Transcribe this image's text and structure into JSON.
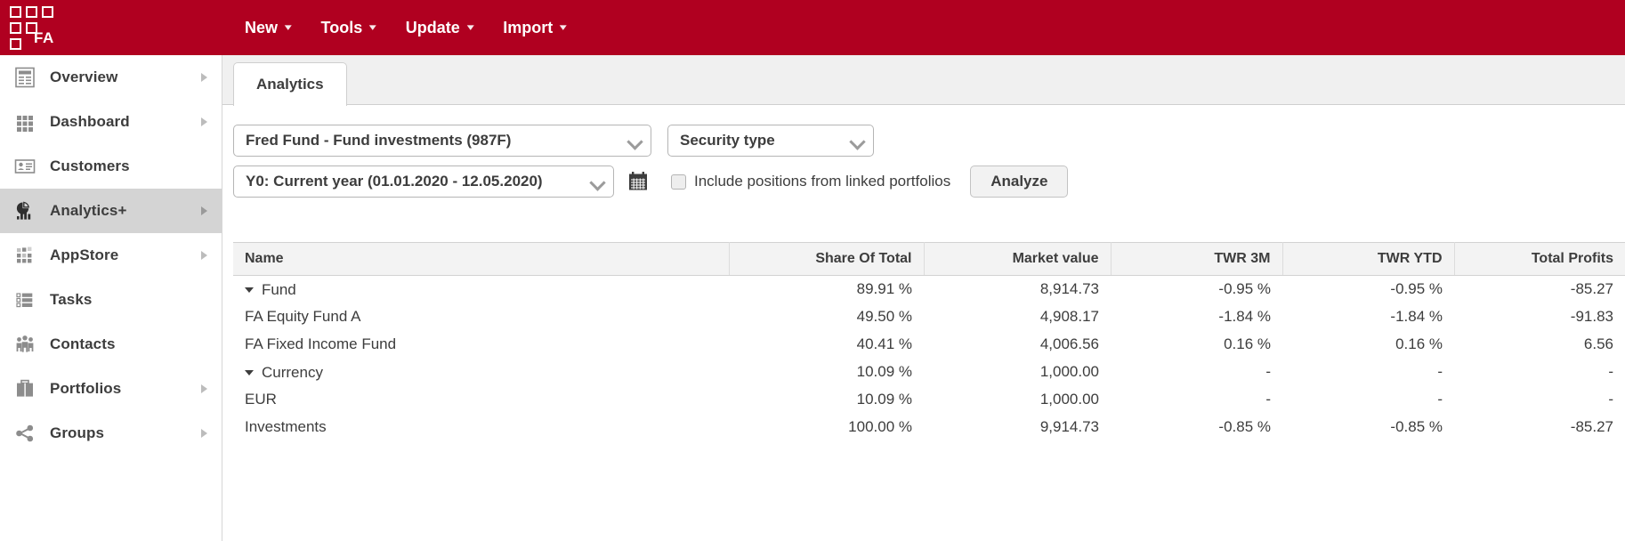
{
  "brand": {
    "name": "FA",
    "color": "#b00020",
    "logo_icon": "fa-squares-logo"
  },
  "topmenu": {
    "items": [
      {
        "label": "New",
        "icon": "chevron-down-icon"
      },
      {
        "label": "Tools",
        "icon": "chevron-down-icon"
      },
      {
        "label": "Update",
        "icon": "chevron-down-icon"
      },
      {
        "label": "Import",
        "icon": "chevron-down-icon"
      }
    ]
  },
  "sidebar": {
    "items": [
      {
        "label": "Overview",
        "icon": "document-overview-icon",
        "has_arrow": true,
        "active": false
      },
      {
        "label": "Dashboard",
        "icon": "grid-dots-icon",
        "has_arrow": true,
        "active": false
      },
      {
        "label": "Customers",
        "icon": "id-card-icon",
        "has_arrow": false,
        "active": false
      },
      {
        "label": "Analytics+",
        "icon": "pie-bar-chart-icon",
        "has_arrow": true,
        "active": true
      },
      {
        "label": "AppStore",
        "icon": "app-grid-icon",
        "has_arrow": true,
        "active": false
      },
      {
        "label": "Tasks",
        "icon": "checklist-icon",
        "has_arrow": false,
        "active": false
      },
      {
        "label": "Contacts",
        "icon": "people-group-icon",
        "has_arrow": false,
        "active": false
      },
      {
        "label": "Portfolios",
        "icon": "briefcase-icon",
        "has_arrow": true,
        "active": false
      },
      {
        "label": "Groups",
        "icon": "share-nodes-icon",
        "has_arrow": true,
        "active": false
      }
    ]
  },
  "tabs": [
    {
      "label": "Analytics",
      "active": true
    }
  ],
  "filters": {
    "portfolio_select": {
      "value": "Fred Fund - Fund investments (987F)",
      "icon": "chevron-down-icon"
    },
    "grouping_select": {
      "value": "Security type",
      "icon": "chevron-down-icon"
    },
    "period_select": {
      "value": "Y0: Current year (01.01.2020 - 12.05.2020)",
      "icon": "chevron-down-icon"
    },
    "calendar_icon": "calendar-icon",
    "include_linked": {
      "label": "Include positions from linked portfolios",
      "checked": false
    },
    "analyze_button": "Analyze"
  },
  "table": {
    "columns": [
      {
        "key": "name",
        "label": "Name",
        "align": "left"
      },
      {
        "key": "share",
        "label": "Share Of Total",
        "align": "right"
      },
      {
        "key": "market",
        "label": "Market value",
        "align": "right"
      },
      {
        "key": "twr3m",
        "label": "TWR 3M",
        "align": "right"
      },
      {
        "key": "twrytd",
        "label": "TWR YTD",
        "align": "right"
      },
      {
        "key": "profit",
        "label": "Total Profits",
        "align": "right"
      }
    ],
    "rows": [
      {
        "name": "Fund",
        "level": "group",
        "expanded": true,
        "share": "89.91 %",
        "market": "8,914.73",
        "twr3m": "-0.95 %",
        "twrytd": "-0.95 %",
        "profit": "-85.27"
      },
      {
        "name": "FA Equity Fund A",
        "level": "child",
        "expanded": null,
        "share": "49.50 %",
        "market": "4,908.17",
        "twr3m": "-1.84 %",
        "twrytd": "-1.84 %",
        "profit": "-91.83"
      },
      {
        "name": "FA Fixed Income Fund",
        "level": "child",
        "expanded": null,
        "share": "40.41 %",
        "market": "4,006.56",
        "twr3m": "0.16 %",
        "twrytd": "0.16 %",
        "profit": "6.56"
      },
      {
        "name": "Currency",
        "level": "group",
        "expanded": true,
        "share": "10.09 %",
        "market": "1,000.00",
        "twr3m": "-",
        "twrytd": "-",
        "profit": "-"
      },
      {
        "name": "EUR",
        "level": "child",
        "expanded": null,
        "share": "10.09 %",
        "market": "1,000.00",
        "twr3m": "-",
        "twrytd": "-",
        "profit": "-"
      },
      {
        "name": "Investments",
        "level": "total",
        "expanded": null,
        "share": "100.00 %",
        "market": "9,914.73",
        "twr3m": "-0.85 %",
        "twrytd": "-0.85 %",
        "profit": "-85.27"
      }
    ]
  }
}
